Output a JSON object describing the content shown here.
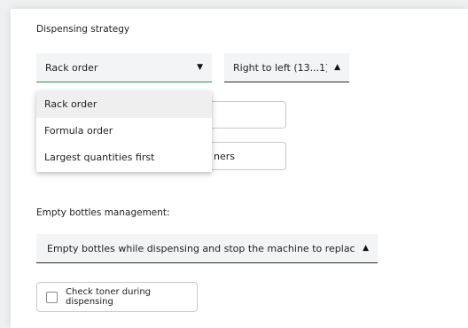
{
  "strategy": {
    "title": "Dispensing strategy",
    "order_select": {
      "value": "Rack order",
      "arrow": "▼"
    },
    "direction_select": {
      "value": "Right to left (13...1)",
      "arrow": "▲"
    },
    "dropdown_options": [
      "Rack order",
      "Formula order",
      "Largest quantities first"
    ],
    "hidden_option_fragment": "ners"
  },
  "empty_bottles": {
    "title": "Empty bottles management:",
    "select": {
      "value": "Empty bottles while dispensing and stop the machine to replace them",
      "arrow": "▲"
    }
  },
  "toner": {
    "label": "Check toner during dispensing",
    "checked": false
  },
  "colors": {
    "accent_green": "#2f8f4e",
    "select_bg": "#f3f4f5"
  }
}
